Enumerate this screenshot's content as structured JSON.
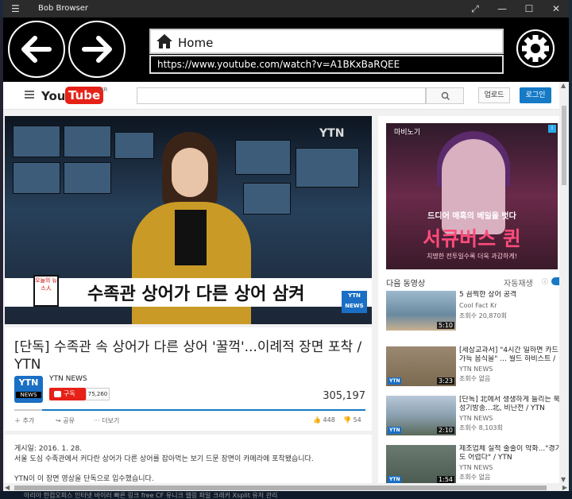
{
  "window": {
    "title": "Bob Browser",
    "controls": [
      "⤢",
      "—",
      "☐",
      "✕"
    ]
  },
  "nav": {
    "home_label": "Home",
    "url": "https://www.youtube.com/watch?v=A1BKxBaRQEE"
  },
  "youtube": {
    "logo_you": "You",
    "logo_tube": "Tube",
    "logo_region": "KR",
    "upload_label": "업로드",
    "login_label": "로그인",
    "video": {
      "top_logo": "YTN",
      "caption": "수족관 상어가 다른 상어 삼켜",
      "badge": "오늘의 뉴스人",
      "news_badge_1": "YTN",
      "news_badge_2": "NEWS",
      "title": "[단독] 수족관 속 상어가 다른 상어 '꿀꺽'...이례적 장면 포착 / YTN",
      "channel_logo_1": "YTN",
      "channel_logo_2": "NEWS",
      "channel": "YTN NEWS",
      "subscribe_label": "구독",
      "subscriber_count": "75,260",
      "view_count": "305,197",
      "add_label": "추가",
      "share_label": "공유",
      "more_label": "더보기",
      "likes": "448",
      "dislikes": "54",
      "like_ratio": 0.92
    },
    "description": {
      "published": "게시일: 2016. 1. 28.",
      "line1": "서울 도심 수족관에서 커다란 상어가 다른 상어를 잡아먹는 보기 드문 장면이 카메라에 포착됐습니다.",
      "line2": "YTN이 이 장면 영상을 단독으로 입수했습니다."
    },
    "ad": {
      "logo": "마비노기",
      "subtitle": "드디어 매혹의 베일을 벗다",
      "title": "서큐버스 퀸",
      "tagline": "치명한 전투일수록 더욱 과감하게!"
    },
    "up_next_label": "다음 동영상",
    "autoplay_label": "자동재생",
    "related": [
      {
        "title": "5 끔찍한 상어 공격",
        "channel": "Cool Fact Kr",
        "views": "조회수 20,870회",
        "duration": "5:10",
        "thumb_color": "#6a8aa0",
        "ytn": ""
      },
      {
        "title": "[세상교과서] \"4시간 일하면 카드",
        "title2": "가득 음식을\" ... 월드 하비스트 /",
        "channel": "YTN NEWS",
        "views": "조회수 없음",
        "duration": "3:23",
        "thumb_color": "#7a6a50",
        "ytn": "YTN"
      },
      {
        "title": "[단독] 北에서 생생하게 들리는 북",
        "title2": "성기방송...北, 비난전 / YTN",
        "channel": "YTN NEWS",
        "views": "조회수 8,103회",
        "duration": "2:10",
        "thumb_color": "#8aa0b0",
        "ytn": "YTN"
      },
      {
        "title": "제조업체 실적 줄줄이 악화...\"경기",
        "title2": "도 어렵다\" / YTN",
        "channel": "YTN NEWS",
        "views": "조회수 없음",
        "duration": "1:54",
        "thumb_color": "#4a5a50",
        "ytn": "YTN"
      }
    ]
  },
  "taskbar": {
    "items": "아리아  한컴오피스  인터넷 바이러  빠른 링크  free CF  유니크 웹링  파일 크래커  Xsplit  유저 관리"
  }
}
